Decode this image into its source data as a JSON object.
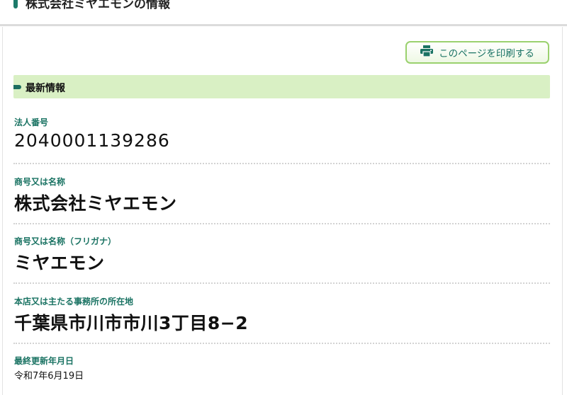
{
  "header": {
    "title": "株式会社ミヤエモンの情報"
  },
  "print_button": {
    "label": "このページを印刷する",
    "icon": "printer-icon",
    "accent_color": "#1a7363",
    "border_color": "#9ad16e"
  },
  "section": {
    "title": "最新情報",
    "background": "#d9f0c4"
  },
  "fields": {
    "corporate_number": {
      "label": "法人番号",
      "value": "2040001139286"
    },
    "name": {
      "label": "商号又は名称",
      "value": "株式会社ミヤエモン"
    },
    "name_kana": {
      "label": "商号又は名称（フリガナ）",
      "value": "ミヤエモン"
    },
    "address": {
      "label": "本店又は主たる事務所の所在地",
      "value": "千葉県市川市市川3丁目8−2"
    },
    "updated": {
      "label": "最終更新年月日",
      "value": "令和7年6月19日"
    }
  }
}
